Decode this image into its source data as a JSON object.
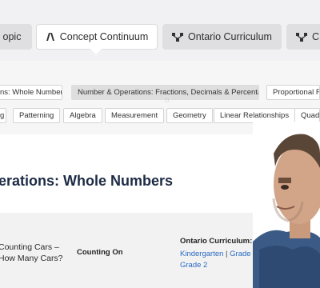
{
  "tabs": [
    {
      "label": "opic",
      "icon": "topic-icon",
      "active": false
    },
    {
      "label": "Concept Continuum",
      "icon": "continuum-icon",
      "active": true
    },
    {
      "label": "Ontario Curriculum",
      "icon": "hierarchy-icon",
      "active": false
    },
    {
      "label": "C",
      "icon": "hierarchy-icon",
      "active": false
    }
  ],
  "strands": [
    {
      "label": "ns: Whole Numbers",
      "selected": false
    },
    {
      "label": "Number & Operations: Fractions, Decimals & Percentages",
      "selected": true
    },
    {
      "label": "Proportional Re",
      "selected": false
    }
  ],
  "topics": [
    {
      "label": "g"
    },
    {
      "label": "Patterning"
    },
    {
      "label": "Algebra"
    },
    {
      "label": "Measurement"
    },
    {
      "label": "Geometry"
    },
    {
      "label": "Linear Relationships"
    },
    {
      "label": "Quadra"
    }
  ],
  "section": {
    "heading": "erations: Whole Numbers"
  },
  "card": {
    "title": "Counting Cars – How Many Cars?",
    "skill": "Counting On",
    "curriculum_label": "Ontario Curriculum:",
    "grades": [
      "Kindergarten",
      "Grade 1",
      "Grade 2"
    ],
    "separator": "|"
  },
  "colors": {
    "tab_bg": "#dfdfe1",
    "band_bg": "#f1f1f3",
    "heading": "#1d2b45",
    "link": "#2a6bc4"
  }
}
